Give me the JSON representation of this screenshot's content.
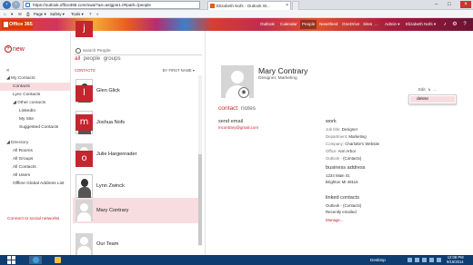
{
  "browser": {
    "address": "https://outlook.office365.com/owa/?ae=asigpin1.0#path=/people",
    "tab_title": "Elizabeth Nofs - Outlook W...",
    "tab_close": "×",
    "window_controls": [
      "–",
      "□",
      "×"
    ],
    "toolbar": {
      "home": "⌂",
      "feeds": "▾",
      "mail": "✉",
      "print": "⎙",
      "page": "Page ▾",
      "safety": "Safety ▾",
      "tools": "Tools ▾",
      "help": "?",
      "extra": "»"
    }
  },
  "o365": {
    "logo": "Office 365",
    "nav": [
      "Outlook",
      "Calendar",
      "People",
      "Newsfeed",
      "OneDrive",
      "Sites",
      "...",
      "Admin ▾"
    ],
    "active_nav": "People",
    "user": "Elizabeth Nofs ▾",
    "icons": [
      "bell-icon",
      "gear-icon",
      "help-icon"
    ]
  },
  "leftnav": {
    "new_label": "new",
    "collapse": "«",
    "items": [
      {
        "label": "◢ My Contacts",
        "indent": 0,
        "type": "hdr"
      },
      {
        "label": "Contacts",
        "indent": 1,
        "type": "sel"
      },
      {
        "label": "Lync Contacts",
        "indent": 1,
        "type": "item"
      },
      {
        "label": "◢ Other contacts",
        "indent": 1,
        "type": "hdr"
      },
      {
        "label": "LinkedIn",
        "indent": 2,
        "type": "item"
      },
      {
        "label": "My Site",
        "indent": 2,
        "type": "item"
      },
      {
        "label": "Suggested Contacts",
        "indent": 2,
        "type": "item"
      },
      {
        "label": "",
        "indent": 0,
        "type": "gap"
      },
      {
        "label": "◢ Directory",
        "indent": 0,
        "type": "hdr"
      },
      {
        "label": "All Rooms",
        "indent": 1,
        "type": "item"
      },
      {
        "label": "All Groups",
        "indent": 1,
        "type": "item"
      },
      {
        "label": "All Contacts",
        "indent": 1,
        "type": "item"
      },
      {
        "label": "All Users",
        "indent": 1,
        "type": "item"
      },
      {
        "label": "Offline Global Address List",
        "indent": 1,
        "type": "item"
      }
    ],
    "connect": "Connect to social networks"
  },
  "search": {
    "placeholder": "search People"
  },
  "filters": {
    "all": "all",
    "people": "people",
    "groups": "groups"
  },
  "list": {
    "header_left": "CONTACTS",
    "header_right": "BY FIRST NAME ▾",
    "rows": [
      {
        "name": "Glen Glick",
        "kind": "photo",
        "selected": false
      },
      {
        "name": "Joshua Nofs",
        "kind": "photo",
        "selected": false
      },
      {
        "name": "Julie Hargenrader",
        "kind": "placeholder",
        "selected": false
      },
      {
        "name": "Lynn Zwinck",
        "kind": "photo",
        "selected": false
      },
      {
        "name": "Mary Contrary",
        "kind": "placeholder",
        "selected": true
      },
      {
        "name": "Our Team",
        "kind": "placeholder",
        "selected": false
      }
    ],
    "letters": [
      "j",
      "l",
      "m",
      "o"
    ]
  },
  "detail": {
    "name": "Mary Contrary",
    "subtitle": "Designer, Marketing",
    "camera": "◉",
    "actions": {
      "edit": "Edit",
      "link": "↳",
      "more": "..."
    },
    "menu_item": "delete",
    "tab_contact": "contact",
    "tab_notes": "notes",
    "send_email_heading": "send email",
    "email": "mcontrary@gmail.com",
    "work_heading": "work",
    "work_fields": [
      {
        "label": "Job title:",
        "value": "Designer"
      },
      {
        "label": "Department:",
        "value": "Marketing"
      },
      {
        "label": "Company:",
        "value": "Charlotte's Website"
      },
      {
        "label": "Office:",
        "value": "Ann Arbor"
      },
      {
        "label": "Outlook -",
        "value": "(Contacts)"
      }
    ],
    "business_heading": "business address",
    "business_lines": [
      "1234 Main St.",
      "Brighton MI 48116"
    ],
    "linked_heading": "linked contacts",
    "linked_lines": [
      "Outlook - (Contacts)",
      "Recently emailed"
    ],
    "manage": "Manage..."
  },
  "taskbar": {
    "desktop": "Desktop",
    "time": "12:08 PM",
    "date": "9/16/2014"
  },
  "colors": {
    "accent": "#c4262e",
    "taskbar": "#0d3d71",
    "selection": "#f8dde0"
  }
}
